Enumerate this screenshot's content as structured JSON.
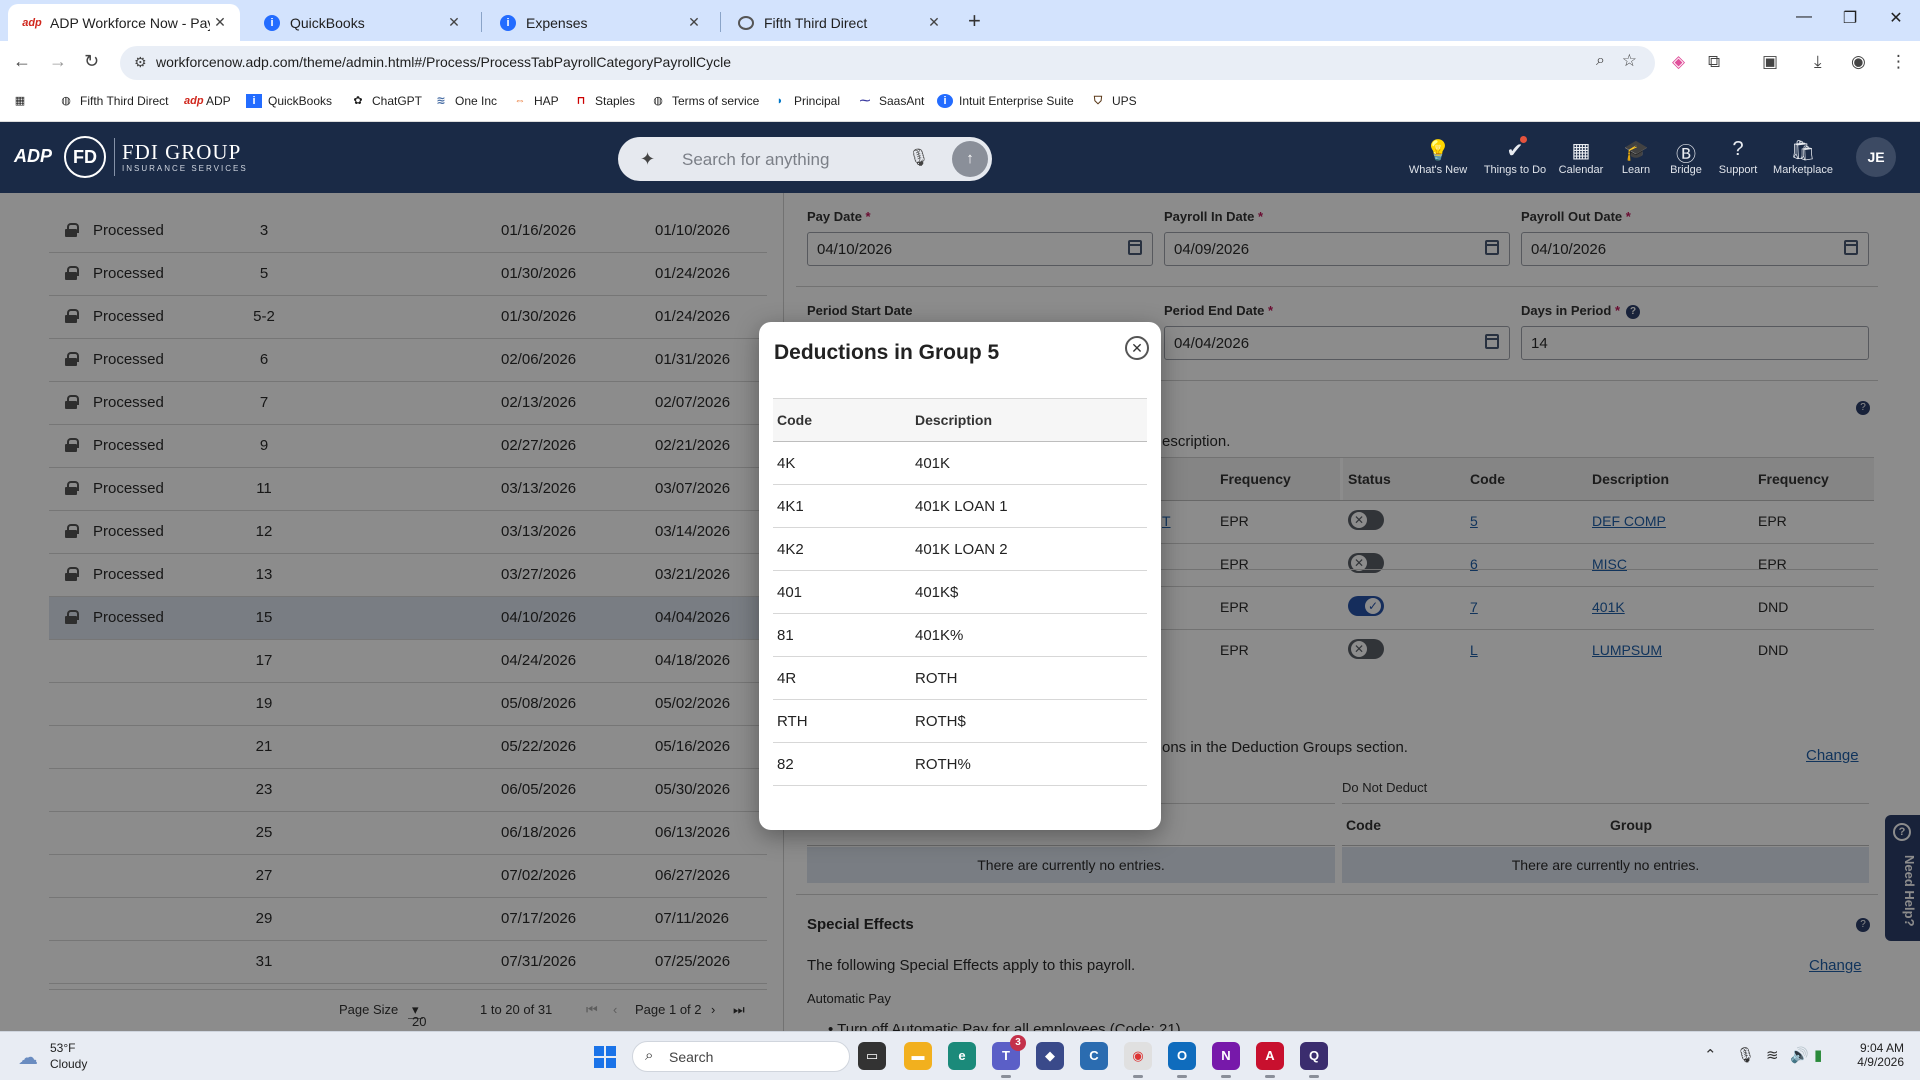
{
  "browser": {
    "tabs": [
      {
        "title": "ADP Workforce Now - Payroll S",
        "icon": "adp-icon",
        "active": true
      },
      {
        "title": "QuickBooks",
        "icon": "intuit-icon",
        "active": false
      },
      {
        "title": "Expenses",
        "icon": "intuit-icon",
        "active": false
      },
      {
        "title": "Fifth Third Direct",
        "icon": "globe-icon",
        "active": false
      }
    ],
    "url": "workforcenow.adp.com/theme/admin.html#/Process/ProcessTabPayrollCategoryPayrollCycle",
    "bookmarks": [
      "Fifth Third Direct",
      "ADP",
      "QuickBooks",
      "ChatGPT",
      "One Inc",
      "HAP",
      "Staples",
      "Terms of service",
      "Principal",
      "SaasAnt",
      "Intuit Enterprise Suite",
      "UPS"
    ]
  },
  "header": {
    "logo_adp": "ADP",
    "brand_name": "FDI GROUP",
    "brand_sub": "INSURANCE SERVICES",
    "search_placeholder": "Search for anything",
    "nav": [
      "What's New",
      "Things to Do",
      "Calendar",
      "Learn",
      "Bridge",
      "Support",
      "Marketplace"
    ],
    "avatar_initials": "JE"
  },
  "cycles": {
    "rows": [
      {
        "status": "Processed",
        "cycle": "3",
        "pay_date": "01/16/2026",
        "period_end": "01/10/2026",
        "locked": true
      },
      {
        "status": "Processed",
        "cycle": "5",
        "pay_date": "01/30/2026",
        "period_end": "01/24/2026",
        "locked": true
      },
      {
        "status": "Processed",
        "cycle": "5-2",
        "pay_date": "01/30/2026",
        "period_end": "01/24/2026",
        "locked": true
      },
      {
        "status": "Processed",
        "cycle": "6",
        "pay_date": "02/06/2026",
        "period_end": "01/31/2026",
        "locked": true
      },
      {
        "status": "Processed",
        "cycle": "7",
        "pay_date": "02/13/2026",
        "period_end": "02/07/2026",
        "locked": true
      },
      {
        "status": "Processed",
        "cycle": "9",
        "pay_date": "02/27/2026",
        "period_end": "02/21/2026",
        "locked": true
      },
      {
        "status": "Processed",
        "cycle": "11",
        "pay_date": "03/13/2026",
        "period_end": "03/07/2026",
        "locked": true
      },
      {
        "status": "Processed",
        "cycle": "12",
        "pay_date": "03/13/2026",
        "period_end": "03/14/2026",
        "locked": true
      },
      {
        "status": "Processed",
        "cycle": "13",
        "pay_date": "03/27/2026",
        "period_end": "03/21/2026",
        "locked": true
      },
      {
        "status": "Processed",
        "cycle": "15",
        "pay_date": "04/10/2026",
        "period_end": "04/04/2026",
        "locked": true,
        "selected": true
      },
      {
        "status": "",
        "cycle": "17",
        "pay_date": "04/24/2026",
        "period_end": "04/18/2026",
        "locked": false
      },
      {
        "status": "",
        "cycle": "19",
        "pay_date": "05/08/2026",
        "period_end": "05/02/2026",
        "locked": false
      },
      {
        "status": "",
        "cycle": "21",
        "pay_date": "05/22/2026",
        "period_end": "05/16/2026",
        "locked": false
      },
      {
        "status": "",
        "cycle": "23",
        "pay_date": "06/05/2026",
        "period_end": "05/30/2026",
        "locked": false
      },
      {
        "status": "",
        "cycle": "25",
        "pay_date": "06/18/2026",
        "period_end": "06/13/2026",
        "locked": false
      },
      {
        "status": "",
        "cycle": "27",
        "pay_date": "07/02/2026",
        "period_end": "06/27/2026",
        "locked": false
      },
      {
        "status": "",
        "cycle": "29",
        "pay_date": "07/17/2026",
        "period_end": "07/11/2026",
        "locked": false
      },
      {
        "status": "",
        "cycle": "31",
        "pay_date": "07/31/2026",
        "period_end": "07/25/2026",
        "locked": false
      }
    ],
    "pager": {
      "page_size_label": "Page Size",
      "page_size": "20",
      "range": "1 to 20 of 31",
      "page": "Page 1 of 2"
    }
  },
  "details": {
    "pay_date_label": "Pay Date",
    "pay_date": "04/10/2026",
    "payroll_in_label": "Payroll In Date",
    "payroll_in": "04/09/2026",
    "payroll_out_label": "Payroll Out Date",
    "payroll_out": "04/10/2026",
    "period_start_label": "Period Start Date",
    "period_end_label": "Period End Date",
    "period_end": "04/04/2026",
    "days_label": "Days in Period",
    "days": "14",
    "required_mark": "*",
    "groups_text_fragment": "escription.",
    "groups_headers_left": [
      "Frequency"
    ],
    "groups_headers_right": [
      "Status",
      "Code",
      "Description",
      "Frequency"
    ],
    "groups_left_freq": [
      "EPR",
      "EPR",
      "EPR",
      "EPR"
    ],
    "groups_left_link_fragment": "T",
    "groups_right": [
      {
        "on": false,
        "code": "5",
        "desc": "DEF COMP",
        "freq": "EPR"
      },
      {
        "on": false,
        "code": "6",
        "desc": "MISC",
        "freq": "EPR"
      },
      {
        "on": true,
        "code": "7",
        "desc": "401K",
        "freq": "DND"
      },
      {
        "on": false,
        "code": "L",
        "desc": "LUMPSUM",
        "freq": "DND"
      }
    ],
    "deduction_text_fragment": "ons in the Deduction Groups section.",
    "change_label": "Change",
    "do_not_deduct_label": "Do Not Deduct",
    "dnd_headers": [
      "Code",
      "Group"
    ],
    "no_entries": "There are currently no entries.",
    "special_effects_title": "Special Effects",
    "special_effects_text": "The following Special Effects apply to this payroll.",
    "automatic_pay_label": "Automatic Pay",
    "automatic_pay_item": "Turn off Automatic Pay for all employees (Code: 21)",
    "need_help": "Need Help?"
  },
  "modal": {
    "title": "Deductions in Group 5",
    "headers": [
      "Code",
      "Description"
    ],
    "rows": [
      {
        "code": "4K",
        "desc": "401K"
      },
      {
        "code": "4K1",
        "desc": "401K LOAN 1"
      },
      {
        "code": "4K2",
        "desc": "401K LOAN 2"
      },
      {
        "code": "401",
        "desc": "401K$"
      },
      {
        "code": "81",
        "desc": "401K%"
      },
      {
        "code": "4R",
        "desc": "ROTH"
      },
      {
        "code": "RTH",
        "desc": "ROTH$"
      },
      {
        "code": "82",
        "desc": "ROTH%"
      }
    ]
  },
  "taskbar": {
    "weather_temp": "53°F",
    "weather_desc": "Cloudy",
    "search_label": "Search",
    "teams_badge": "3",
    "time": "9:04 AM",
    "date": "4/9/2026"
  },
  "colors": {
    "header_bg": "#1a2a46",
    "tabstrip_bg": "#d3e3fd",
    "link": "#1f5fa8",
    "selected_row": "#dde3ee",
    "required": "#c2185b"
  }
}
